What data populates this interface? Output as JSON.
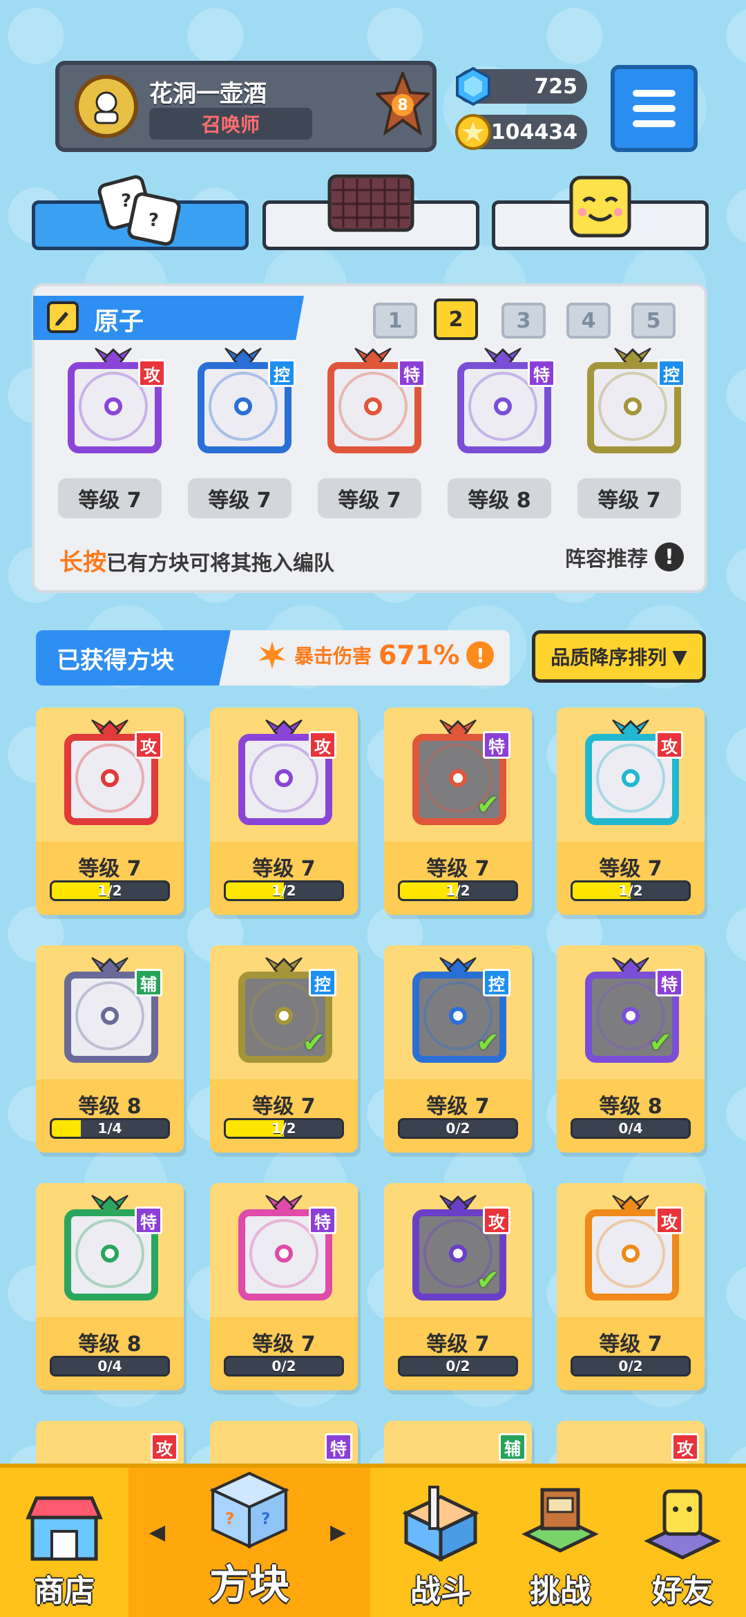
{
  "header": {
    "player_name": "花洞一壶酒",
    "role": "召唤师",
    "rank": "8",
    "gems": "725",
    "coins": "104434"
  },
  "team": {
    "name": "原子",
    "pages": [
      "1",
      "2",
      "3",
      "4",
      "5"
    ],
    "active_page": "2",
    "slots": [
      {
        "level": "等级 7",
        "tag": "攻",
        "tag_color": "#e8343a",
        "color": "#8a45d8"
      },
      {
        "level": "等级 7",
        "tag": "控",
        "tag_color": "#1d8ff0",
        "color": "#2a6fd6"
      },
      {
        "level": "等级 7",
        "tag": "特",
        "tag_color": "#8c3fd8",
        "color": "#e0563a"
      },
      {
        "level": "等级 8",
        "tag": "特",
        "tag_color": "#8c3fd8",
        "color": "#7a4fd6"
      },
      {
        "level": "等级 7",
        "tag": "控",
        "tag_color": "#1d8ff0",
        "color": "#a5953a"
      }
    ],
    "hint_highlight": "长按",
    "hint_text": "已有方块可将其拖入编队",
    "recommend": "阵容推荐"
  },
  "owned": {
    "title": "已获得方块",
    "crit_label": "暴击伤害",
    "crit_value": "671%",
    "sort_label": "品质降序排列",
    "cards": [
      {
        "level": "等级 7",
        "progress": "1/2",
        "fill": 0.5,
        "tag": "攻",
        "tag_color": "#e8343a",
        "color": "#e03a3a",
        "dim": false
      },
      {
        "level": "等级 7",
        "progress": "1/2",
        "fill": 0.5,
        "tag": "攻",
        "tag_color": "#e8343a",
        "color": "#8a45d8",
        "dim": false
      },
      {
        "level": "等级 7",
        "progress": "1/2",
        "fill": 0.5,
        "tag": "特",
        "tag_color": "#8c3fd8",
        "color": "#e0563a",
        "dim": true
      },
      {
        "level": "等级 7",
        "progress": "1/2",
        "fill": 0.5,
        "tag": "攻",
        "tag_color": "#e8343a",
        "color": "#21b8cf",
        "dim": false
      },
      {
        "level": "等级 8",
        "progress": "1/4",
        "fill": 0.25,
        "tag": "辅",
        "tag_color": "#27a35a",
        "color": "#6a6a9a",
        "dim": false
      },
      {
        "level": "等级 7",
        "progress": "1/2",
        "fill": 0.5,
        "tag": "控",
        "tag_color": "#1d8ff0",
        "color": "#a5953a",
        "dim": true
      },
      {
        "level": "等级 7",
        "progress": "0/2",
        "fill": 0,
        "tag": "控",
        "tag_color": "#1d8ff0",
        "color": "#2a6fd6",
        "dim": true
      },
      {
        "level": "等级 8",
        "progress": "0/4",
        "fill": 0,
        "tag": "特",
        "tag_color": "#8c3fd8",
        "color": "#7a4fd6",
        "dim": true
      },
      {
        "level": "等级 8",
        "progress": "0/4",
        "fill": 0,
        "tag": "特",
        "tag_color": "#8c3fd8",
        "color": "#2aa65e",
        "dim": false
      },
      {
        "level": "等级 7",
        "progress": "0/2",
        "fill": 0,
        "tag": "特",
        "tag_color": "#8c3fd8",
        "color": "#e04aa8",
        "dim": false
      },
      {
        "level": "等级 7",
        "progress": "0/2",
        "fill": 0,
        "tag": "攻",
        "tag_color": "#e8343a",
        "color": "#6a3fc8",
        "dim": true
      },
      {
        "level": "等级 7",
        "progress": "0/2",
        "fill": 0,
        "tag": "攻",
        "tag_color": "#e8343a",
        "color": "#f08a1a",
        "dim": false
      }
    ],
    "partial_tags": [
      {
        "tag": "攻",
        "tag_color": "#e8343a"
      },
      {
        "tag": "特",
        "tag_color": "#8c3fd8"
      },
      {
        "tag": "辅",
        "tag_color": "#27a35a"
      },
      {
        "tag": "攻",
        "tag_color": "#e8343a"
      }
    ]
  },
  "nav": {
    "shop": "商店",
    "blocks": "方块",
    "battle": "战斗",
    "challenge": "挑战",
    "friends": "好友",
    "active": "blocks"
  },
  "icons": [
    "gem-icon",
    "coin-icon",
    "menu-icon",
    "dice-icon",
    "board-icon",
    "face-icon",
    "pencil-icon",
    "shop-icon",
    "block-icon",
    "battle-icon",
    "challenge-icon",
    "friends-icon"
  ]
}
